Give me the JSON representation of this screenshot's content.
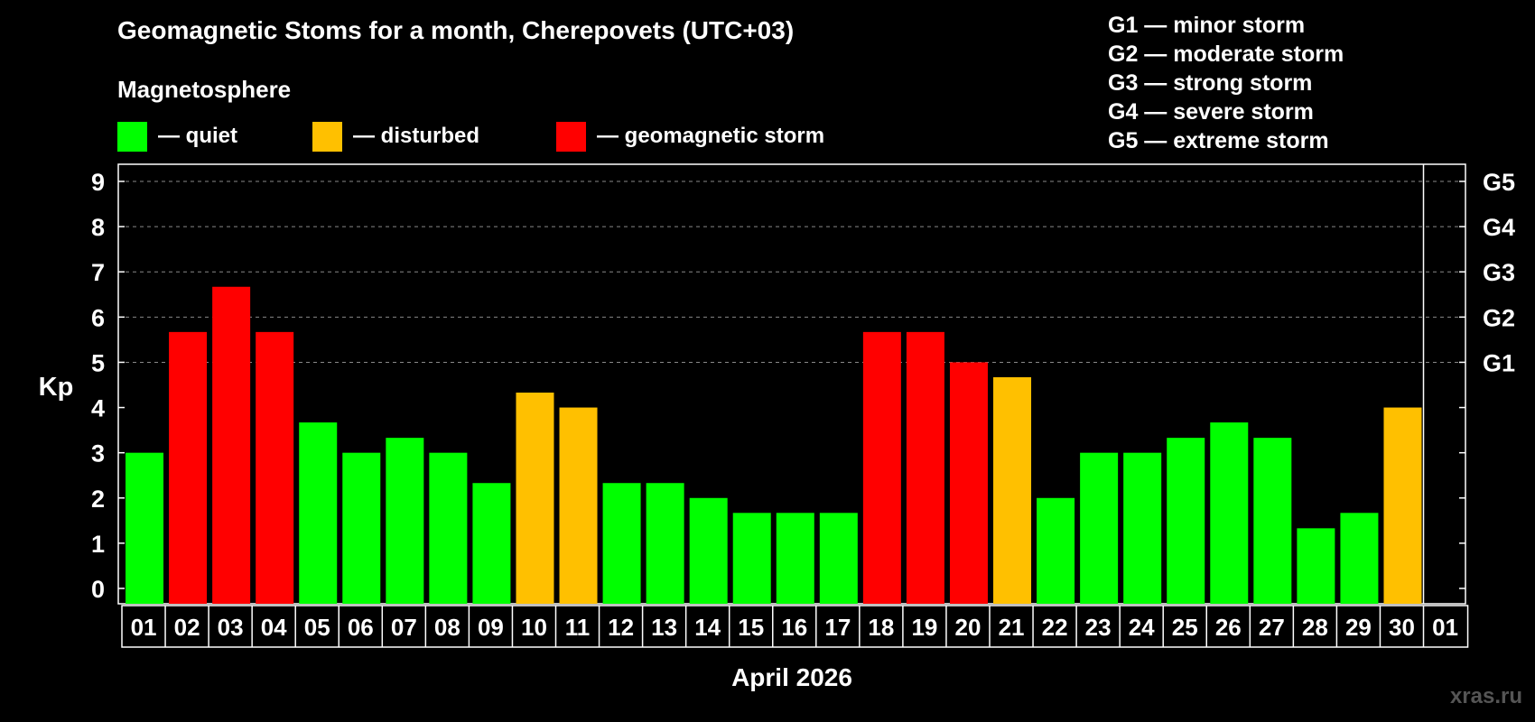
{
  "header": {
    "title": "Geomagnetic Stoms for a month, Cherepovets (UTC+03)",
    "subtitle": "Magnetosphere"
  },
  "legend": [
    {
      "label": "— quiet",
      "color": "#00ff00"
    },
    {
      "label": "— disturbed",
      "color": "#ffc000"
    },
    {
      "label": "— geomagnetic storm",
      "color": "#ff0000"
    }
  ],
  "g_scale": [
    "G1 — minor storm",
    "G2 — moderate storm",
    "G3 — strong storm",
    "G4 — severe storm",
    "G5 — extreme storm"
  ],
  "watermark": "xras.ru",
  "chart_data": {
    "type": "bar",
    "ylabel": "Kp",
    "xlabel": "April 2026",
    "ylim": [
      0,
      9
    ],
    "yticks": [
      0,
      1,
      2,
      3,
      4,
      5,
      6,
      7,
      8,
      9
    ],
    "grid": "dashed horizontal from Kp 5 to 9",
    "right_axis_labels": [
      {
        "kp": 5,
        "label": "G1"
      },
      {
        "kp": 6,
        "label": "G2"
      },
      {
        "kp": 7,
        "label": "G3"
      },
      {
        "kp": 8,
        "label": "G4"
      },
      {
        "kp": 9,
        "label": "G5"
      }
    ],
    "categories": [
      "01",
      "02",
      "03",
      "04",
      "05",
      "06",
      "07",
      "08",
      "09",
      "10",
      "11",
      "12",
      "13",
      "14",
      "15",
      "16",
      "17",
      "18",
      "19",
      "20",
      "21",
      "22",
      "23",
      "24",
      "25",
      "26",
      "27",
      "28",
      "29",
      "30",
      "01"
    ],
    "values": [
      3.0,
      5.67,
      6.67,
      5.67,
      3.67,
      3.0,
      3.33,
      3.0,
      2.33,
      4.33,
      4.0,
      2.33,
      2.33,
      2.0,
      1.67,
      1.67,
      1.67,
      5.67,
      5.67,
      5.0,
      4.67,
      2.0,
      3.0,
      3.0,
      3.33,
      3.67,
      3.33,
      1.33,
      1.67,
      4.0,
      null
    ],
    "status": [
      "quiet",
      "storm",
      "storm",
      "storm",
      "quiet",
      "quiet",
      "quiet",
      "quiet",
      "quiet",
      "disturbed",
      "disturbed",
      "quiet",
      "quiet",
      "quiet",
      "quiet",
      "quiet",
      "quiet",
      "storm",
      "storm",
      "storm",
      "disturbed",
      "quiet",
      "quiet",
      "quiet",
      "quiet",
      "quiet",
      "quiet",
      "quiet",
      "quiet",
      "disturbed",
      null
    ],
    "status_colors": {
      "quiet": "#00ff00",
      "disturbed": "#ffc000",
      "storm": "#ff0000"
    }
  }
}
